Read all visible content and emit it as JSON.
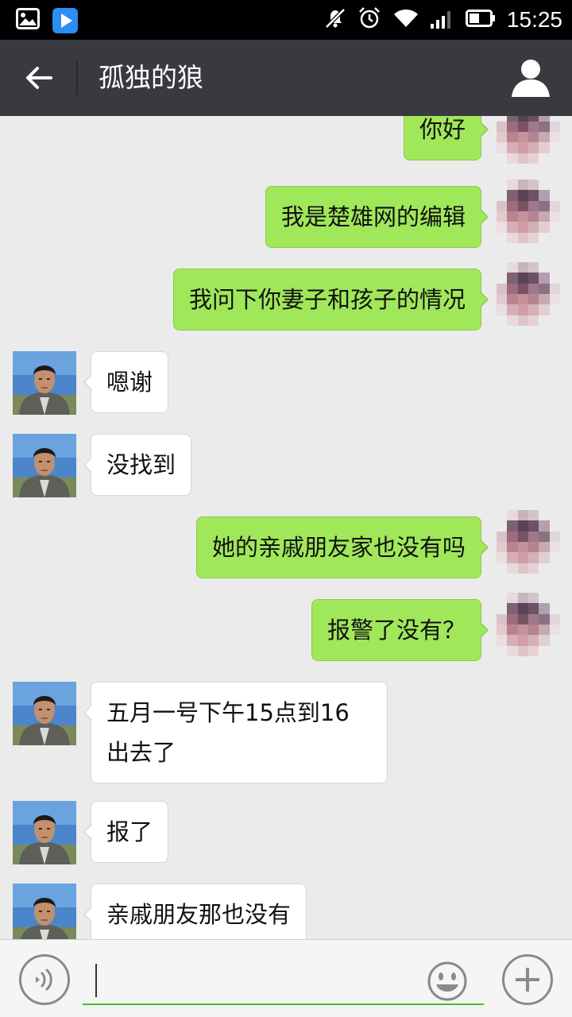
{
  "status_bar": {
    "time": "15:25",
    "left_icons": [
      "gallery-notification-icon",
      "video-player-notification-icon"
    ],
    "right_icons": [
      "mute-icon",
      "alarm-icon",
      "wifi-icon",
      "signal-icon",
      "battery-icon"
    ]
  },
  "header": {
    "title": "孤独的狼",
    "back_icon": "back-arrow-icon",
    "profile_icon": "person-icon",
    "background_color": "#393a3f"
  },
  "messages": [
    {
      "side": "out",
      "text": "你好"
    },
    {
      "side": "out",
      "text": "我是楚雄网的编辑"
    },
    {
      "side": "out",
      "text": "我问下你妻子和孩子的情况"
    },
    {
      "side": "in",
      "text": "嗯谢"
    },
    {
      "side": "in",
      "text": "没找到"
    },
    {
      "side": "out",
      "text": "她的亲戚朋友家也没有吗"
    },
    {
      "side": "out",
      "text": "报警了没有？"
    },
    {
      "side": "in",
      "text": "五月一号下午15点到16出去了"
    },
    {
      "side": "in",
      "text": "报了"
    },
    {
      "side": "in",
      "text": "亲戚朋友那也没有"
    }
  ],
  "colors": {
    "outgoing_bubble": "#a0e75a",
    "incoming_bubble": "#ffffff",
    "chat_background": "#ebebeb",
    "input_underline": "#45c01a"
  },
  "input": {
    "value": "",
    "voice_icon": "voice-icon",
    "emoji_icon": "emoji-icon",
    "plus_icon": "plus-icon"
  }
}
